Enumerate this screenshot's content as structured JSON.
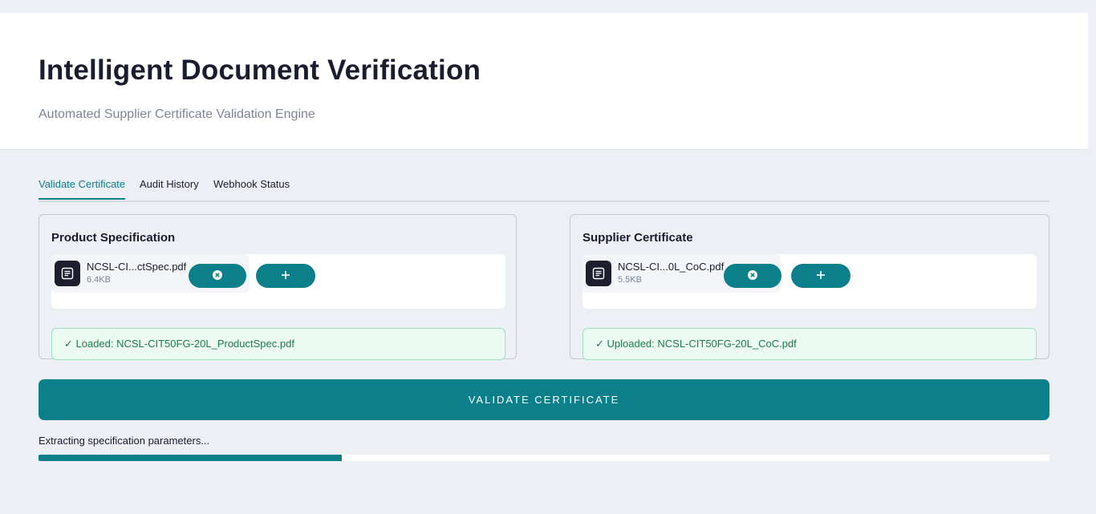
{
  "header": {
    "title": "Intelligent Document Verification",
    "subtitle": "Automated Supplier Certificate Validation Engine"
  },
  "tabs": [
    {
      "label": "Validate Certificate",
      "active": true
    },
    {
      "label": "Audit History",
      "active": false
    },
    {
      "label": "Webhook Status",
      "active": false
    }
  ],
  "product_spec": {
    "title": "Product Specification",
    "file_name": "NCSL-CI...ctSpec.pdf",
    "file_size": "6.4KB",
    "status": "✓ Loaded: NCSL-CIT50FG-20L_ProductSpec.pdf"
  },
  "supplier_cert": {
    "title": "Supplier Certificate",
    "file_name": "NCSL-CI...0L_CoC.pdf",
    "file_size": "5.5KB",
    "status": "✓ Uploaded: NCSL-CIT50FG-20L_CoC.pdf"
  },
  "icons": {
    "file": "document-icon",
    "remove": "close-circle-icon",
    "add": "plus-icon"
  },
  "validate_button": "VALIDATE CERTIFICATE",
  "progress": {
    "label": "Extracting specification parameters...",
    "fraction": 0.3
  },
  "colors": {
    "accent": "#0b7f8a",
    "success_bg": "#ebfaf3",
    "success_text": "#1f7a4a"
  }
}
